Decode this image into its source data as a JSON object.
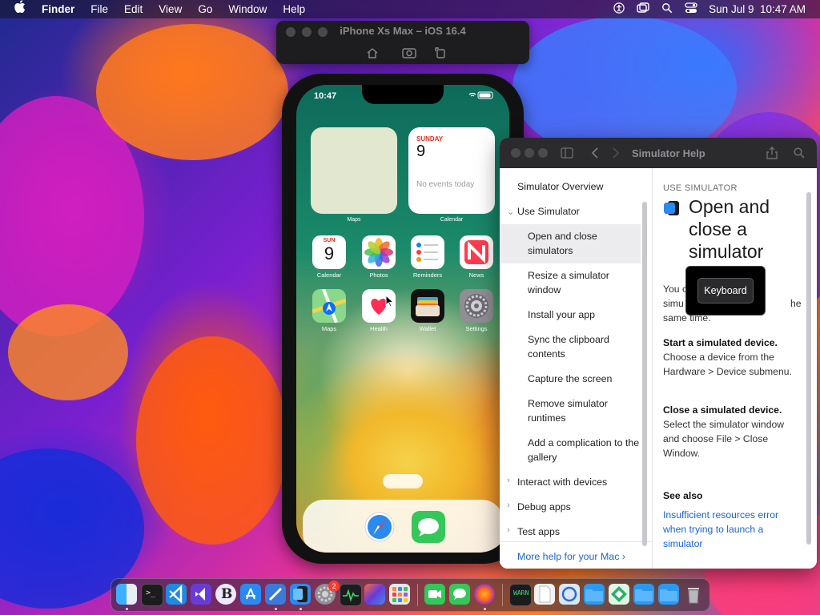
{
  "menubar": {
    "apple": "",
    "app": "Finder",
    "items": [
      "File",
      "Edit",
      "View",
      "Go",
      "Window",
      "Help"
    ],
    "clock": "Sun Jul 9  10:47 AM"
  },
  "simulator": {
    "title": "iPhone Xs Max – iOS 16.4",
    "phone": {
      "time": "10:47",
      "widgets": {
        "maps_label": "Maps",
        "calendar_day": "SUNDAY",
        "calendar_date": "9",
        "calendar_events": "No events today",
        "calendar_label": "Calendar"
      },
      "apps": [
        {
          "label": "Calendar",
          "day": "SUN",
          "date": "9"
        },
        {
          "label": "Photos"
        },
        {
          "label": "Reminders"
        },
        {
          "label": "News"
        },
        {
          "label": "Maps"
        },
        {
          "label": "Health"
        },
        {
          "label": "Wallet"
        },
        {
          "label": "Settings"
        }
      ]
    }
  },
  "help": {
    "title": "Simulator Help",
    "sidebar": [
      {
        "label": "Simulator Overview"
      },
      {
        "label": "Use Simulator"
      },
      {
        "label": "Open and close simulators"
      },
      {
        "label": "Resize a simulator window"
      },
      {
        "label": "Install your app"
      },
      {
        "label": "Sync the clipboard contents"
      },
      {
        "label": "Capture the screen"
      },
      {
        "label": "Remove simulator runtimes"
      },
      {
        "label": "Add a complication to the gallery"
      },
      {
        "label": "Interact with devices"
      },
      {
        "label": "Debug apps"
      },
      {
        "label": "Test apps"
      }
    ],
    "more_help": "More help for your Mac ›",
    "main": {
      "section": "USE SIMULATOR",
      "heading": "Open and close a simulator",
      "intro_start": "You c",
      "intro_line2a": "simu",
      "intro_line2b": "he",
      "intro_line3": "same time.",
      "start_title": "Start a simulated device.",
      "start_text": "Choose a device from the Hardware > Device submenu.",
      "close_title": "Close a simulated device.",
      "close_text": "Select the simulator window and choose File > Close Window.",
      "see_also": "See also",
      "see_also_link": "Insufficient resources error when trying to launch a simulator"
    }
  },
  "popup": {
    "keyboard": "Keyboard"
  },
  "dock": {
    "badge": "2"
  }
}
